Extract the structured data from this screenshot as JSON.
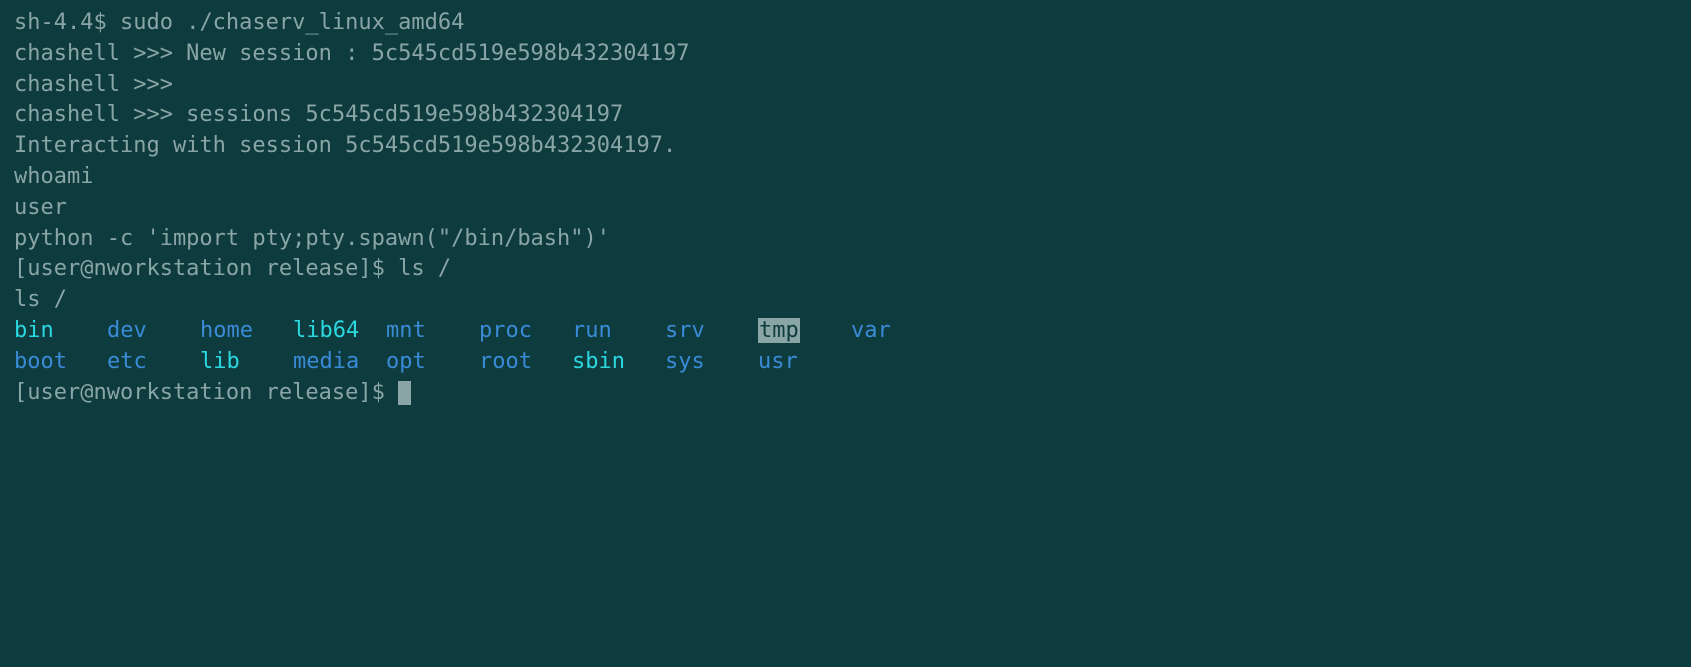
{
  "lines": {
    "l1_prompt": "sh-4.4$ ",
    "l1_cmd": "sudo ./chaserv_linux_amd64",
    "l2": "chashell >>> New session : 5c545cd519e598b432304197",
    "l3": "chashell >>>",
    "l4": "chashell >>> sessions 5c545cd519e598b432304197",
    "l5": "Interacting with session 5c545cd519e598b432304197.",
    "l6": "whoami",
    "l7": "user",
    "l8": "python -c 'import pty;pty.spawn(\"/bin/bash\")'",
    "l9": "[user@nworkstation release]$ ls /",
    "l10": "ls /",
    "l13": "[user@nworkstation release]$ "
  },
  "ls": {
    "row1": [
      {
        "name": "bin",
        "color": "cyan"
      },
      {
        "name": "dev",
        "color": "blue"
      },
      {
        "name": "home",
        "color": "blue"
      },
      {
        "name": "lib64",
        "color": "cyan"
      },
      {
        "name": "mnt",
        "color": "blue"
      },
      {
        "name": "proc",
        "color": "blue"
      },
      {
        "name": "run",
        "color": "blue"
      },
      {
        "name": "srv",
        "color": "blue"
      },
      {
        "name": "tmp",
        "color": "hl"
      },
      {
        "name": "var",
        "color": "blue"
      }
    ],
    "row2": [
      {
        "name": "boot",
        "color": "blue"
      },
      {
        "name": "etc",
        "color": "blue"
      },
      {
        "name": "lib",
        "color": "cyan"
      },
      {
        "name": "media",
        "color": "blue"
      },
      {
        "name": "opt",
        "color": "blue"
      },
      {
        "name": "root",
        "color": "blue"
      },
      {
        "name": "sbin",
        "color": "cyan"
      },
      {
        "name": "sys",
        "color": "blue"
      },
      {
        "name": "usr",
        "color": "blue"
      }
    ]
  }
}
